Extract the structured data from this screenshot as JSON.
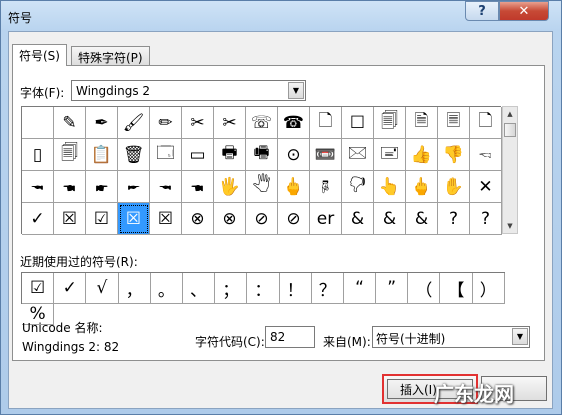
{
  "window": {
    "title": "符号",
    "help_label": "?",
    "close_label": "✕"
  },
  "tabs": [
    {
      "label": "符号(S)"
    },
    {
      "label": "特殊字符(P)"
    }
  ],
  "font": {
    "label": "字体(F):",
    "value": "Wingdings 2",
    "dropdown_arrow": "▼"
  },
  "symbol_grid": {
    "selected_index": 48,
    "cells": [
      "",
      "✎",
      "✒",
      "🖌",
      "✏",
      "✂",
      "✂",
      "☏",
      "☎",
      "🗋",
      "☐",
      "🗐",
      "🗎",
      "🗏",
      "🗋",
      "▯",
      "🗐",
      "📋",
      "🗑",
      "🗔",
      "▭",
      "🖶",
      "🖷",
      "⊙",
      "📼",
      "🖂",
      "🖃",
      "👍",
      "👎",
      "🖘",
      "🖚",
      "🖜",
      "🖝",
      "🖛",
      "🖚",
      "🖜",
      "🖐",
      "🖑",
      "🖕",
      "🖗",
      "🖓",
      "👆",
      "🖕",
      "✋",
      "✕",
      "✓",
      "☒",
      "☑",
      "☒",
      "☒",
      "⊗",
      "⊗",
      "⊘",
      "⊘",
      "er",
      "&",
      "&",
      "&",
      "?",
      "?"
    ]
  },
  "scrollbar": {
    "up_arrow": "▲",
    "down_arrow": "▼"
  },
  "recent": {
    "label": "近期使用过的符号(R):",
    "items": [
      "☑",
      "✓",
      "√",
      "，",
      "。",
      "、",
      "；",
      "：",
      "！",
      "？",
      "“",
      "”",
      "（",
      "【",
      "）",
      "%"
    ]
  },
  "unicode": {
    "name_label": "Unicode 名称:",
    "name_value": "Wingdings 2: 82"
  },
  "char_code": {
    "label": "字符代码(C):",
    "value": "82"
  },
  "from": {
    "label": "来自(M):",
    "value": "符号(十进制)",
    "dropdown_arrow": "▼"
  },
  "buttons": {
    "insert_label": "插入(I)"
  },
  "watermark": {
    "text": "广东龙网"
  }
}
